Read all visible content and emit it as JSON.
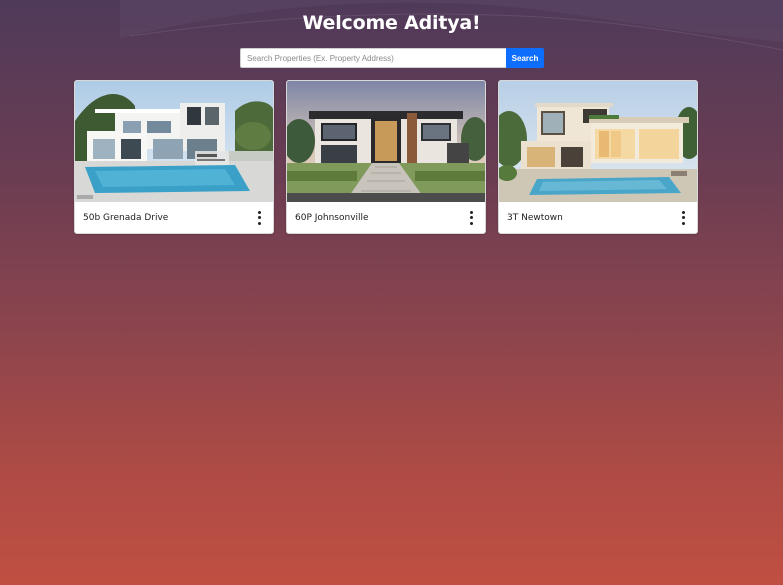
{
  "header": {
    "title": "Welcome Aditya!"
  },
  "search": {
    "placeholder": "Search Properties (Ex. Property Address)",
    "value": "",
    "button_label": "Search"
  },
  "properties": [
    {
      "address": "50b Grenada Drive",
      "menu_icon": "kebab-icon"
    },
    {
      "address": "60P Johnsonville",
      "menu_icon": "kebab-icon"
    },
    {
      "address": "3T Newtown",
      "menu_icon": "kebab-icon"
    }
  ],
  "colors": {
    "accent": "#0d6efd",
    "background_top": "#4f3a5a",
    "background_bottom": "#c04f42"
  }
}
